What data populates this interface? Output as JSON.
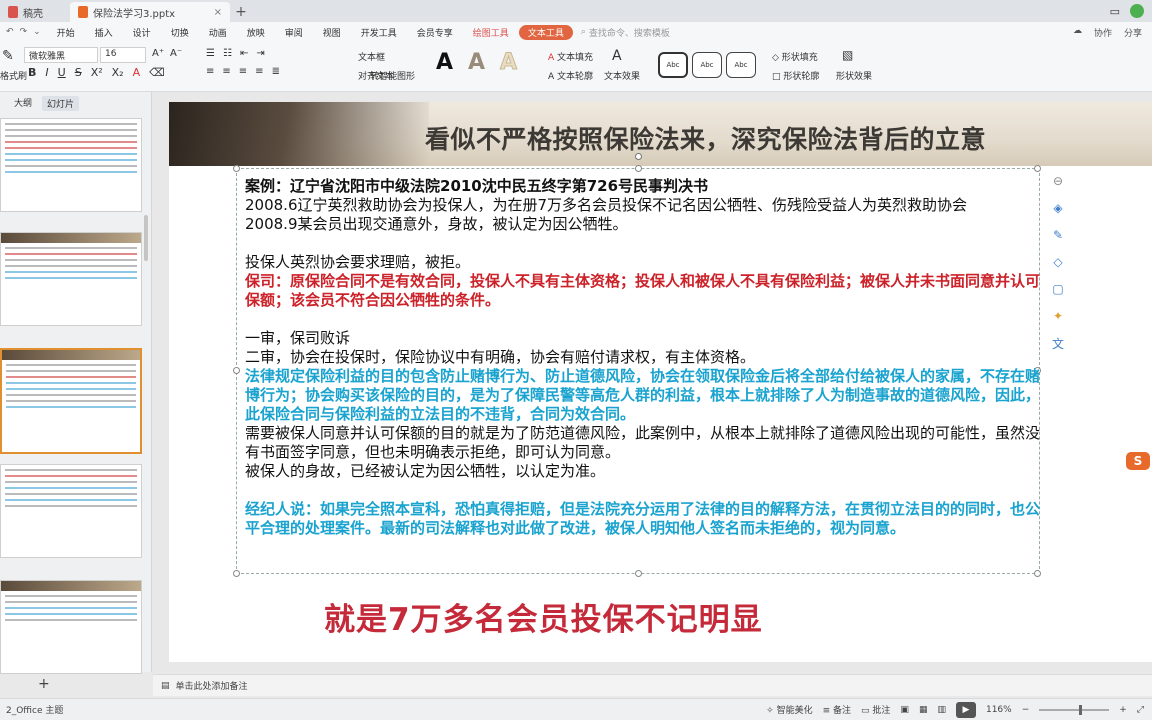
{
  "titlebar": {
    "tab_home": "稿壳",
    "tab_doc": "保险法学习3.pptx",
    "tab_close": "×",
    "add_tab": "+"
  },
  "menubar": {
    "items": [
      "开始",
      "插入",
      "设计",
      "切换",
      "动画",
      "放映",
      "审阅",
      "视图",
      "开发工具",
      "会员专享"
    ],
    "drawing_tools": "绘图工具",
    "text_tools": "文本工具",
    "search_placeholder": "查找命令、搜索模板",
    "right_items": [
      "协作",
      "分享"
    ]
  },
  "toolbar": {
    "format_painter": "格式刷",
    "font_name": "微软雅黑",
    "font_size": "16",
    "text_box": "文本框",
    "align_text": "对齐文本",
    "smart_graphic": "转智能图形",
    "text_fill": "文本填充",
    "text_outline": "文本轮廓",
    "text_effect": "文本效果",
    "style_label": "Abc",
    "shape_fill": "形状填充",
    "shape_outline": "形状轮廓",
    "shape_effect": "形状效果"
  },
  "leftpane": {
    "tab_outline": "大纲",
    "tab_slides": "幻灯片",
    "add_slide": "+"
  },
  "slide": {
    "title": "看似不严格按照保险法来，深究保险法背后的立意",
    "case_heading": "案例：辽宁省沈阳市中级法院2010沈中民五终字第726号民事判决书",
    "line1": "2008.6辽宁英烈救助协会为投保人，为在册7万多名会员投保不记名因公牺牲、伤残险受益人为英烈救助协会",
    "line2": "2008.9某会员出现交通意外，身故，被认定为因公牺牲。",
    "line3": "投保人英烈协会要求理赔，被拒。",
    "insurer_view": "保司：原保险合同不是有效合同，投保人不具有主体资格；投保人和被保人不具有保险利益；被保人并未书面同意并认可保额；该会员不符合因公牺牲的条件。",
    "first_trial": "一审，保司败诉",
    "second_trial": "二审，协会在投保时，保险协议中有明确，协会有赔付请求权，有主体资格。",
    "law_purpose": "法律规定保险利益的目的包含防止赌博行为、防止道德风险，协会在领取保险金后将全部给付给被保人的家属，不存在赌博行为；协会购买该保险的目的，是为了保障民警等高危人群的利益，根本上就排除了人为制造事故的道德风险，因此，此保险合同与保险利益的立法目的不违背，合同为效合同。",
    "consent": "需要被保人同意并认可保额的目的就是为了防范道德风险，此案例中，从根本上就排除了道德风险出现的可能性，虽然没有书面签字同意，但也未明确表示拒绝，即可认为同意。",
    "death": "被保人的身故，已经被认定为因公牺牲，以认定为准。",
    "broker": "经纪人说：如果完全照本宣科，恐怕真得拒赔，但是法院充分运用了法律的目的解释方法，在贯彻立法目的的同时，也公平合理的处理案件。最新的司法解释也对此做了改进，被保人明知他人签名而未拒绝的，视为同意。",
    "caption": "就是7万多名会员投保不记明显"
  },
  "notes": {
    "placeholder": "单击此处添加备注"
  },
  "statusbar": {
    "slide_info": "2_Office 主题",
    "smart_beautify": "智能美化",
    "notes_btn": "备注",
    "comments_btn": "批注",
    "zoom": "116%"
  },
  "colors": {
    "accent_orange": "#e06540",
    "red_text": "#cc2229",
    "blue_text": "#1aa3cf",
    "caption_red": "#c52a3a"
  }
}
